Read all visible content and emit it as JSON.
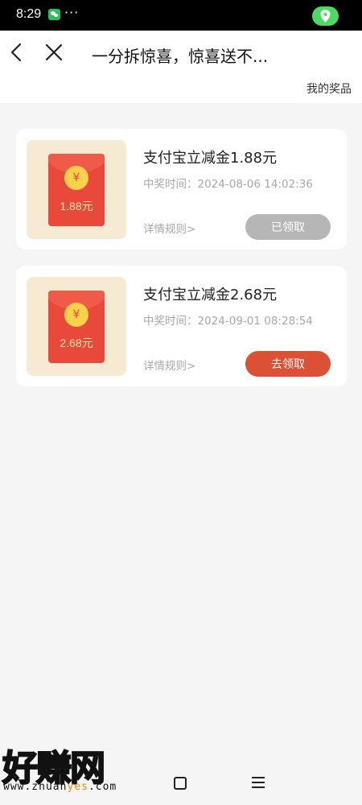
{
  "status_bar": {
    "time": "8:29",
    "icons": [
      "wechat-icon",
      "more-dots-icon",
      "location-icon"
    ],
    "more": "···",
    "location_color": "#4cd964"
  },
  "nav": {
    "title": "一分拆惊喜，惊喜送不...",
    "my_prizes": "我的奖品",
    "icons": [
      "back-icon",
      "close-icon"
    ]
  },
  "prizes": [
    {
      "name": "支付宝立减金1.88元",
      "time_label": "中奖时间：",
      "time": "2024-08-06 14:02:36",
      "rules": "详情规则>",
      "envelope_symbol": "¥",
      "envelope_amount": "1.88元",
      "button": "已领取",
      "button_color": "#b6b6b6"
    },
    {
      "name": "支付宝立减金2.68元",
      "time_label": "中奖时间：",
      "time": "2024-09-01 08:28:54",
      "rules": "详情规则>",
      "envelope_symbol": "¥",
      "envelope_amount": "2.68元",
      "button": "去领取",
      "button_color": "#dc5035"
    }
  ],
  "bottom_nav": {
    "icons": [
      "home-square-icon",
      "menu-icon"
    ]
  },
  "watermark": {
    "logo": "好赚网",
    "url_prefix": "www.zhuan",
    "url_highlight": "yes",
    "url_suffix": ".com"
  },
  "colors": {
    "accent": "#dc5035",
    "envelope": "#e8493a",
    "coin": "#fbd14b",
    "thumb_bg": "#f7ead2"
  }
}
